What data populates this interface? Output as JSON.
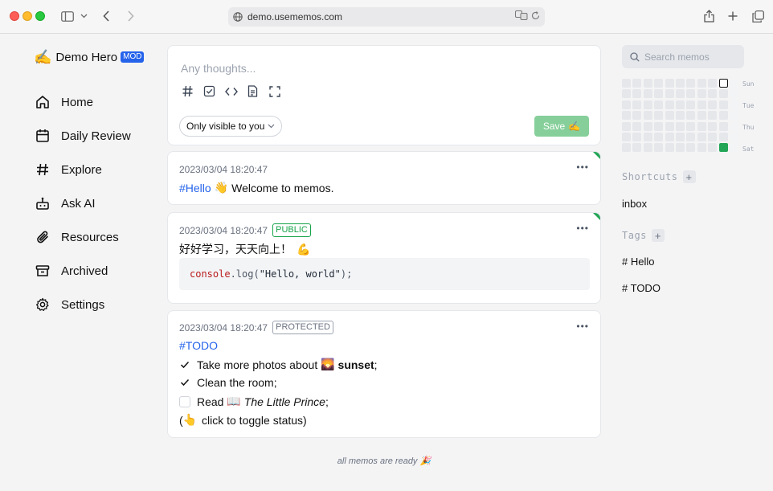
{
  "browser": {
    "url": "demo.usememos.com"
  },
  "user": {
    "avatar_emoji": "✍️",
    "name": "Demo Hero",
    "role_badge": "MOD"
  },
  "nav": {
    "items": [
      {
        "label": "Home",
        "icon": "home-icon"
      },
      {
        "label": "Daily Review",
        "icon": "calendar-icon"
      },
      {
        "label": "Explore",
        "icon": "hash-icon"
      },
      {
        "label": "Ask AI",
        "icon": "bot-icon"
      },
      {
        "label": "Resources",
        "icon": "paperclip-icon"
      },
      {
        "label": "Archived",
        "icon": "archive-icon"
      },
      {
        "label": "Settings",
        "icon": "gear-icon"
      }
    ]
  },
  "editor": {
    "placeholder": "Any thoughts...",
    "visibility": "Only visible to you",
    "save_label": "Save",
    "save_emoji": "✍️"
  },
  "memos": [
    {
      "timestamp": "2023/03/04 18:20:47",
      "tag": "#Hello",
      "emoji": "👋",
      "text": "Welcome to memos."
    },
    {
      "timestamp": "2023/03/04 18:20:47",
      "visibility": "PUBLIC",
      "text": "好好学习，天天向上！",
      "emoji": "💪",
      "code_obj": "console",
      "code_fn": ".log(",
      "code_str": "\"Hello, world\"",
      "code_end": ");"
    },
    {
      "timestamp": "2023/03/04 18:20:47",
      "visibility": "PROTECTED",
      "tag": "#TODO",
      "tasks": [
        {
          "pre": "Take more photos about ",
          "emoji": "🌄",
          "bold": "sunset",
          "post": ";",
          "checked": true
        },
        {
          "pre": "Clean the room;",
          "checked": true
        },
        {
          "pre": "Read ",
          "emoji": "📖",
          "italic": "The Little Prince",
          "post": ";",
          "checked": false
        }
      ],
      "hint_open": "(",
      "hint_emoji": "👆",
      "hint_text": " click to toggle status)"
    }
  ],
  "footer": {
    "text": "all memos are ready",
    "emoji": "🎉"
  },
  "sidebar_right": {
    "search_placeholder": "Search memos",
    "heatmap_days": [
      "Sun",
      "Tue",
      "Thu",
      "Sat"
    ],
    "shortcuts_title": "Shortcuts",
    "shortcuts": [
      "inbox"
    ],
    "tags_title": "Tags",
    "tags": [
      "# Hello",
      "# TODO"
    ]
  },
  "colors": {
    "accent_blue": "#2563eb",
    "save_green": "#86cf9a",
    "activity_green": "#22a556"
  }
}
